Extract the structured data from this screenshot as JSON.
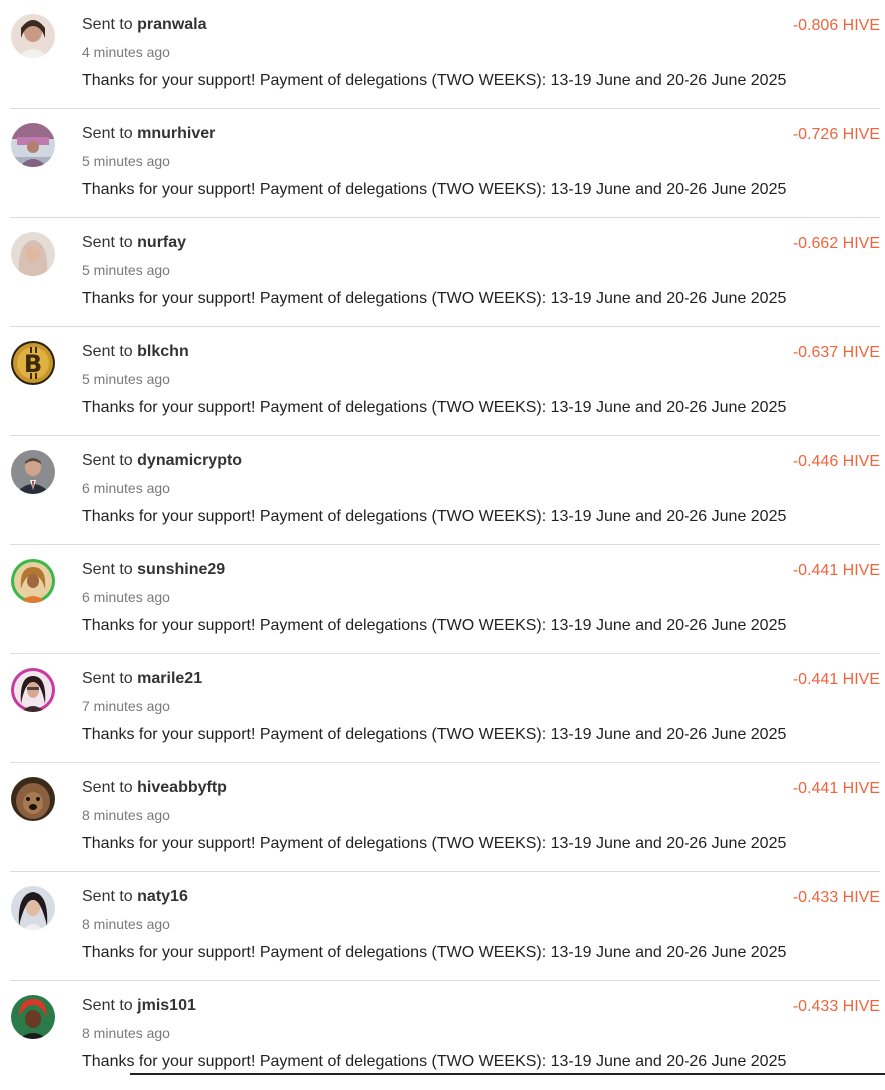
{
  "transfers": [
    {
      "prefix": "Sent to",
      "user": "pranwala",
      "time": "4 minutes ago",
      "amount": "-0.806 HIVE",
      "memo": "Thanks for your support! Payment of delegations (TWO WEEKS): 13-19 June and 20-26 June 2025",
      "avatar_color": "#e8d8d0"
    },
    {
      "prefix": "Sent to",
      "user": "mnurhiver",
      "time": "5 minutes ago",
      "amount": "-0.726 HIVE",
      "memo": "Thanks for your support! Payment of delegations (TWO WEEKS): 13-19 June and 20-26 June 2025",
      "avatar_color": "#b07a9a"
    },
    {
      "prefix": "Sent to",
      "user": "nurfay",
      "time": "5 minutes ago",
      "amount": "-0.662 HIVE",
      "memo": "Thanks for your support! Payment of delegations (TWO WEEKS): 13-19 June and 20-26 June 2025",
      "avatar_color": "#d8c8c0"
    },
    {
      "prefix": "Sent to",
      "user": "blkchn",
      "time": "5 minutes ago",
      "amount": "-0.637 HIVE",
      "memo": "Thanks for your support! Payment of delegations (TWO WEEKS): 13-19 June and 20-26 June 2025",
      "avatar_color": "#c89a2a"
    },
    {
      "prefix": "Sent to",
      "user": "dynamicrypto",
      "time": "6 minutes ago",
      "amount": "-0.446 HIVE",
      "memo": "Thanks for your support! Payment of delegations (TWO WEEKS): 13-19 June and 20-26 June 2025",
      "avatar_color": "#4a4a52"
    },
    {
      "prefix": "Sent to",
      "user": "sunshine29",
      "time": "6 minutes ago",
      "amount": "-0.441 HIVE",
      "memo": "Thanks for your support! Payment of delegations (TWO WEEKS): 13-19 June and 20-26 June 2025",
      "avatar_color": "#d0a860"
    },
    {
      "prefix": "Sent to",
      "user": "marile21",
      "time": "7 minutes ago",
      "amount": "-0.441 HIVE",
      "memo": "Thanks for your support! Payment of delegations (TWO WEEKS): 13-19 June and 20-26 June 2025",
      "avatar_color": "#c84a9a"
    },
    {
      "prefix": "Sent to",
      "user": "hiveabbyftp",
      "time": "8 minutes ago",
      "amount": "-0.441 HIVE",
      "memo": "Thanks for your support! Payment of delegations (TWO WEEKS): 13-19 June and 20-26 June 2025",
      "avatar_color": "#6a4a30"
    },
    {
      "prefix": "Sent to",
      "user": "naty16",
      "time": "8 minutes ago",
      "amount": "-0.433 HIVE",
      "memo": "Thanks for your support! Payment of delegations (TWO WEEKS): 13-19 June and 20-26 June 2025",
      "avatar_color": "#3a3a44"
    },
    {
      "prefix": "Sent to",
      "user": "jmis101",
      "time": "8 minutes ago",
      "amount": "-0.433 HIVE",
      "memo": "Thanks for your support! Payment of delegations (TWO WEEKS): 13-19 June and 20-26 June 2025",
      "avatar_color": "#c83a2a"
    }
  ],
  "colors": {
    "amount": "#f0643c",
    "divider": "#dcdcdc",
    "time": "#7a7a7a"
  }
}
